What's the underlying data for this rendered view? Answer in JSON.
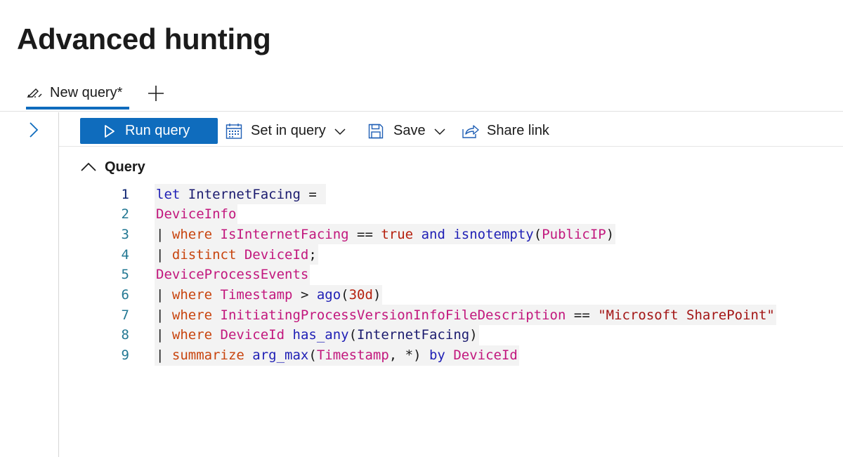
{
  "page": {
    "title": "Advanced hunting"
  },
  "tabs": {
    "active_label": "New query*",
    "add_icon": "plus-icon",
    "edit_icon": "edit-query-icon"
  },
  "side_panel": {
    "expand_icon": "chevron-right-icon"
  },
  "toolbar": {
    "run_label": "Run query",
    "set_in_query_label": "Set in query",
    "save_label": "Save",
    "share_label": "Share link",
    "accent_color": "#0f6cbd"
  },
  "query_section": {
    "label": "Query",
    "collapse_icon": "chevron-up-icon"
  },
  "editor": {
    "lines": [
      {
        "n": "1",
        "tokens": [
          {
            "t": "let",
            "c": "fn"
          },
          {
            "t": " ",
            "c": "plain"
          },
          {
            "t": "InternetFacing",
            "c": "id"
          },
          {
            "t": " = ",
            "c": "op"
          }
        ]
      },
      {
        "n": "2",
        "tokens": [
          {
            "t": "DeviceInfo",
            "c": "tbl"
          }
        ]
      },
      {
        "n": "3",
        "tokens": [
          {
            "t": "| ",
            "c": "pipe"
          },
          {
            "t": "where",
            "c": "kw"
          },
          {
            "t": " ",
            "c": "plain"
          },
          {
            "t": "IsInternetFacing",
            "c": "tbl"
          },
          {
            "t": " == ",
            "c": "op"
          },
          {
            "t": "true",
            "c": "lit"
          },
          {
            "t": " ",
            "c": "plain"
          },
          {
            "t": "and",
            "c": "fn"
          },
          {
            "t": " ",
            "c": "plain"
          },
          {
            "t": "isnotempty",
            "c": "fn"
          },
          {
            "t": "(",
            "c": "op"
          },
          {
            "t": "PublicIP",
            "c": "tbl"
          },
          {
            "t": ")",
            "c": "op"
          }
        ]
      },
      {
        "n": "4",
        "tokens": [
          {
            "t": "| ",
            "c": "pipe"
          },
          {
            "t": "distinct",
            "c": "kw"
          },
          {
            "t": " ",
            "c": "plain"
          },
          {
            "t": "DeviceId",
            "c": "tbl"
          },
          {
            "t": ";",
            "c": "op"
          }
        ]
      },
      {
        "n": "5",
        "tokens": [
          {
            "t": "DeviceProcessEvents",
            "c": "tbl"
          }
        ]
      },
      {
        "n": "6",
        "tokens": [
          {
            "t": "| ",
            "c": "pipe"
          },
          {
            "t": "where",
            "c": "kw"
          },
          {
            "t": " ",
            "c": "plain"
          },
          {
            "t": "Timestamp",
            "c": "tbl"
          },
          {
            "t": " > ",
            "c": "op"
          },
          {
            "t": "ago",
            "c": "fn"
          },
          {
            "t": "(",
            "c": "op"
          },
          {
            "t": "30d",
            "c": "lit"
          },
          {
            "t": ")",
            "c": "op"
          }
        ]
      },
      {
        "n": "7",
        "tokens": [
          {
            "t": "| ",
            "c": "pipe"
          },
          {
            "t": "where",
            "c": "kw"
          },
          {
            "t": " ",
            "c": "plain"
          },
          {
            "t": "InitiatingProcessVersionInfoFileDescription",
            "c": "tbl"
          },
          {
            "t": " == ",
            "c": "op"
          },
          {
            "t": "\"Microsoft SharePoint\"",
            "c": "str"
          }
        ]
      },
      {
        "n": "8",
        "tokens": [
          {
            "t": "| ",
            "c": "pipe"
          },
          {
            "t": "where",
            "c": "kw"
          },
          {
            "t": " ",
            "c": "plain"
          },
          {
            "t": "DeviceId",
            "c": "tbl"
          },
          {
            "t": " ",
            "c": "plain"
          },
          {
            "t": "has_any",
            "c": "fn"
          },
          {
            "t": "(",
            "c": "op"
          },
          {
            "t": "InternetFacing",
            "c": "id"
          },
          {
            "t": ")",
            "c": "op"
          }
        ]
      },
      {
        "n": "9",
        "tokens": [
          {
            "t": "| ",
            "c": "pipe"
          },
          {
            "t": "summarize",
            "c": "kw"
          },
          {
            "t": " ",
            "c": "plain"
          },
          {
            "t": "arg_max",
            "c": "fn"
          },
          {
            "t": "(",
            "c": "op"
          },
          {
            "t": "Timestamp",
            "c": "tbl"
          },
          {
            "t": ", *) ",
            "c": "op"
          },
          {
            "t": "by",
            "c": "fn"
          },
          {
            "t": " ",
            "c": "plain"
          },
          {
            "t": "DeviceId",
            "c": "tbl"
          }
        ]
      }
    ]
  }
}
